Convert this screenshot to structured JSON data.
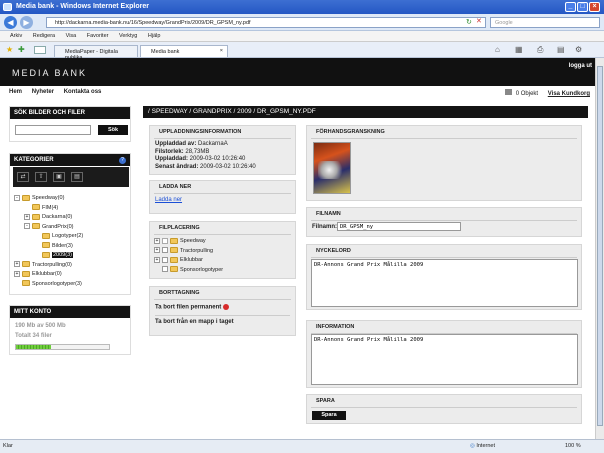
{
  "browser": {
    "title": "Media bank - Windows Internet Explorer",
    "url": "http://dackarna.media-bank.nu/16/Speedway/GrandPrix/2009/DR_GPSM_ny.pdf",
    "search_placeholder": "Google",
    "menus": [
      "Arkiv",
      "Redigera",
      "Visa",
      "Favoriter",
      "Verktyg",
      "Hjälp"
    ],
    "tabs": [
      "MediaPaper - Digitala publika...",
      "Media bank"
    ],
    "status_left": "Klar",
    "status_zone": "Internet",
    "zoom": "100 %"
  },
  "site": {
    "logo": "MEDIA BANK",
    "logout": "logga ut",
    "nav": [
      "Hem",
      "Nyheter",
      "Kontakta oss"
    ],
    "objects": "0 Objekt",
    "cart_link": "Visa Kundkorg"
  },
  "left": {
    "search_title": "SÖK BILDER OCH FILER",
    "search_button": "Sök",
    "categories_title": "KATEGORIER",
    "tree": [
      {
        "label": "Speedway(0)",
        "level": 0,
        "toggle": "-"
      },
      {
        "label": "FIM(4)",
        "level": 1,
        "toggle": ""
      },
      {
        "label": "Dackarna(0)",
        "level": 1,
        "toggle": "+"
      },
      {
        "label": "GrandPrix(0)",
        "level": 1,
        "toggle": "-"
      },
      {
        "label": "Logotyper(2)",
        "level": 2,
        "toggle": ""
      },
      {
        "label": "Bilder(3)",
        "level": 2,
        "toggle": ""
      },
      {
        "label": "2009(3)",
        "level": 2,
        "toggle": "",
        "selected": true
      },
      {
        "label": "Tractorpulling(0)",
        "level": 0,
        "toggle": "+"
      },
      {
        "label": "Elklubbar(0)",
        "level": 0,
        "toggle": "+"
      },
      {
        "label": "Sponsorlogotyper(3)",
        "level": 0,
        "toggle": ""
      }
    ],
    "account_title": "MITT KONTO",
    "usage": "190 Mb av 500 Mb",
    "files": "Totalt 34 filer",
    "usage_fraction": 0.38
  },
  "breadcrumb": "/ SPEEDWAY / GRANDPRIX / 2009 / DR_GPSM_NY.PDF",
  "upload": {
    "title": "UPPLADDNINGSINFORMATION",
    "rows": [
      {
        "label": "Uppladdad av:",
        "value": "DackarnaA"
      },
      {
        "label": "Filstorlek:",
        "value": "28,73MB"
      },
      {
        "label": "Uppladdad:",
        "value": "2009-03-02 10:26:40"
      },
      {
        "label": "Senast ändrad:",
        "value": "2009-03-02 10:26:40"
      }
    ]
  },
  "download": {
    "title": "LADDA NER",
    "link": "Ladda ner"
  },
  "placement": {
    "title": "FILPLACERING",
    "items": [
      {
        "label": "Speedway",
        "toggle": "+"
      },
      {
        "label": "Tractorpulling",
        "toggle": "+"
      },
      {
        "label": "Elklubbar",
        "toggle": "+"
      },
      {
        "label": "Sponsorlogotyper",
        "toggle": ""
      }
    ]
  },
  "removal": {
    "title": "BORTTAGNING",
    "delete": "Ta bort filen permanent",
    "remove_folder": "Ta bort från en mapp i taget"
  },
  "preview": {
    "title": "FÖRHANDSGRANSKNING"
  },
  "filename": {
    "title": "FILNAMN",
    "label": "Filnamn:",
    "value": "DR_GPSM_ny"
  },
  "keywords": {
    "title": "NYCKELORD",
    "value": "DR-Annons Grand Prix Målilla 2009"
  },
  "information": {
    "title": "INFORMATION",
    "value": "DR-Annons Grand Prix Målilla 2009"
  },
  "save": {
    "title": "SPARA",
    "button": "Spara"
  }
}
